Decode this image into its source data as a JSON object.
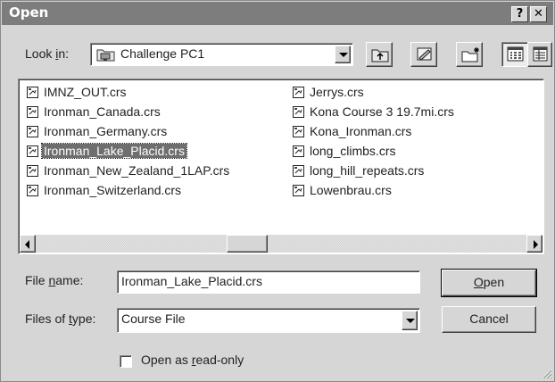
{
  "window": {
    "title": "Open",
    "help_label": "?",
    "close_label": "✕"
  },
  "lookin": {
    "label_prefix": "Look ",
    "label_accel": "i",
    "label_suffix": "n:",
    "value": "Challenge PC1"
  },
  "files": {
    "left": [
      {
        "name": "IMNZ_OUT.crs",
        "selected": false
      },
      {
        "name": "Ironman_Canada.crs",
        "selected": false
      },
      {
        "name": "Ironman_Germany.crs",
        "selected": false
      },
      {
        "name": "Ironman_Lake_Placid.crs",
        "selected": true
      },
      {
        "name": "Ironman_New_Zealand_1LAP.crs",
        "selected": false
      },
      {
        "name": "Ironman_Switzerland.crs",
        "selected": false
      }
    ],
    "right": [
      {
        "name": "Jerrys.crs",
        "selected": false
      },
      {
        "name": "Kona Course 3 19.7mi.crs",
        "selected": false
      },
      {
        "name": "Kona_Ironman.crs",
        "selected": false
      },
      {
        "name": "long_climbs.crs",
        "selected": false
      },
      {
        "name": "long_hill_repeats.crs",
        "selected": false
      },
      {
        "name": "Lowenbrau.crs",
        "selected": false
      }
    ]
  },
  "filename": {
    "label_prefix": "File ",
    "label_accel": "n",
    "label_suffix": "ame:",
    "value": "Ironman_Lake_Placid.crs"
  },
  "filetype": {
    "label_prefix": "Files of ",
    "label_accel": "t",
    "label_suffix": "ype:",
    "value": "Course File"
  },
  "buttons": {
    "open_accel": "O",
    "open_rest": "pen",
    "cancel": "Cancel"
  },
  "readonly": {
    "label_prefix": "Open as ",
    "label_accel": "r",
    "label_suffix": "ead-only",
    "checked": false
  },
  "icons": {
    "folder": "network-folder-icon",
    "up": "up-one-level-icon",
    "desktop": "desktop-icon",
    "new_folder": "new-folder-icon",
    "list_view": "list-view-icon",
    "details_view": "details-view-icon",
    "file": "crs-file-icon"
  },
  "colors": {
    "title_bar": "#7d7d7d",
    "dialog_bg": "#d6d6d6",
    "selection_bg": "#6e6e6e"
  }
}
